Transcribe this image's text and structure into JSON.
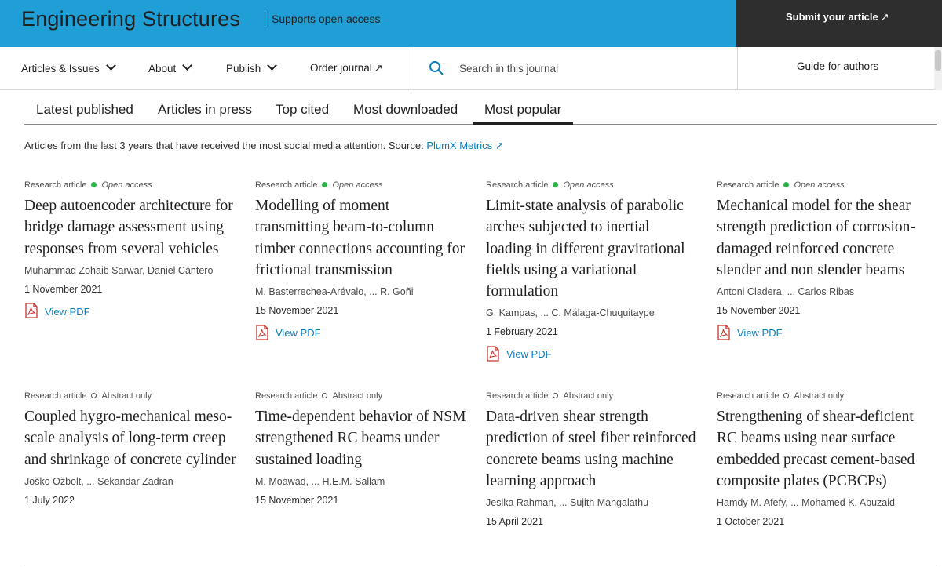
{
  "header": {
    "journal_title": "Engineering Structures",
    "open_access_tag": "Supports open access",
    "submit_label": "Submit your article",
    "submit_arrow": "↗",
    "brand_color": "#1f9fd6"
  },
  "nav": {
    "items": [
      {
        "label": "Articles & Issues",
        "icon": "chevron-down-icon"
      },
      {
        "label": "About",
        "icon": "chevron-down-icon"
      },
      {
        "label": "Publish",
        "icon": "chevron-down-icon"
      },
      {
        "label": "Order journal",
        "icon": "external-link-icon"
      }
    ],
    "external_arrow": "↗",
    "search_placeholder": "Search in this journal",
    "guide_label": "Guide for authors"
  },
  "tabs": [
    {
      "label": "Latest published",
      "active": false
    },
    {
      "label": "Articles in press",
      "active": false
    },
    {
      "label": "Top cited",
      "active": false
    },
    {
      "label": "Most downloaded",
      "active": false
    },
    {
      "label": "Most popular",
      "active": true
    }
  ],
  "description": {
    "text": "Articles from the last 3 years that have received the most social media attention. Source: ",
    "link": "PlumX Metrics",
    "link_arrow": "↗"
  },
  "articles": [
    {
      "type": "Research article",
      "access": "Open access",
      "title": "Deep autoencoder architecture for bridge damage assessment using responses from several vehicles",
      "authors": "Muhammad Zohaib Sarwar, Daniel Cantero",
      "date": "1 November 2021",
      "pdf": "View PDF"
    },
    {
      "type": "Research article",
      "access": "Open access",
      "title": "Modelling of moment transmitting beam-to-column timber connections accounting for frictional transmission",
      "authors": "M. Basterrechea-Arévalo, ... R. Goñi",
      "date": "15 November 2021",
      "pdf": "View PDF"
    },
    {
      "type": "Research article",
      "access": "Open access",
      "title": "Limit-state analysis of parabolic arches subjected to inertial loading in different gravitational fields using a variational formulation",
      "authors": "G. Kampas, ... C. Málaga-Chuquitaype",
      "date": "1 February 2021",
      "pdf": "View PDF"
    },
    {
      "type": "Research article",
      "access": "Open access",
      "title": "Mechanical model for the shear strength prediction of corrosion-damaged reinforced concrete slender and non slender beams",
      "authors": "Antoni Cladera, ... Carlos Ribas",
      "date": "15 November 2021",
      "pdf": "View PDF"
    },
    {
      "type": "Research article",
      "access": "Abstract only",
      "title": "Coupled hygro-mechanical meso-scale analysis of long-term creep and shrinkage of concrete cylinder",
      "authors": "Joško Ožbolt, ... Sekandar Zadran",
      "date": "1 July 2022",
      "pdf": ""
    },
    {
      "type": "Research article",
      "access": "Abstract only",
      "title": "Time-dependent behavior of NSM strengthened RC beams under sustained loading",
      "authors": "M. Moawad, ... H.E.M. Sallam",
      "date": "15 November 2021",
      "pdf": ""
    },
    {
      "type": "Research article",
      "access": "Abstract only",
      "title": "Data-driven shear strength prediction of steel fiber reinforced concrete beams using machine learning approach",
      "authors": "Jesika Rahman, ... Sujith Mangalathu",
      "date": "15 April 2021",
      "pdf": ""
    },
    {
      "type": "Research article",
      "access": "Abstract only",
      "title": "Strengthening of shear-deficient RC beams using near surface embedded precast cement-based composite plates (PCBCPs)",
      "authors": "Hamdy M. Afefy, ... Mohamed K. Abuzaid",
      "date": "1 October 2021",
      "pdf": ""
    }
  ]
}
